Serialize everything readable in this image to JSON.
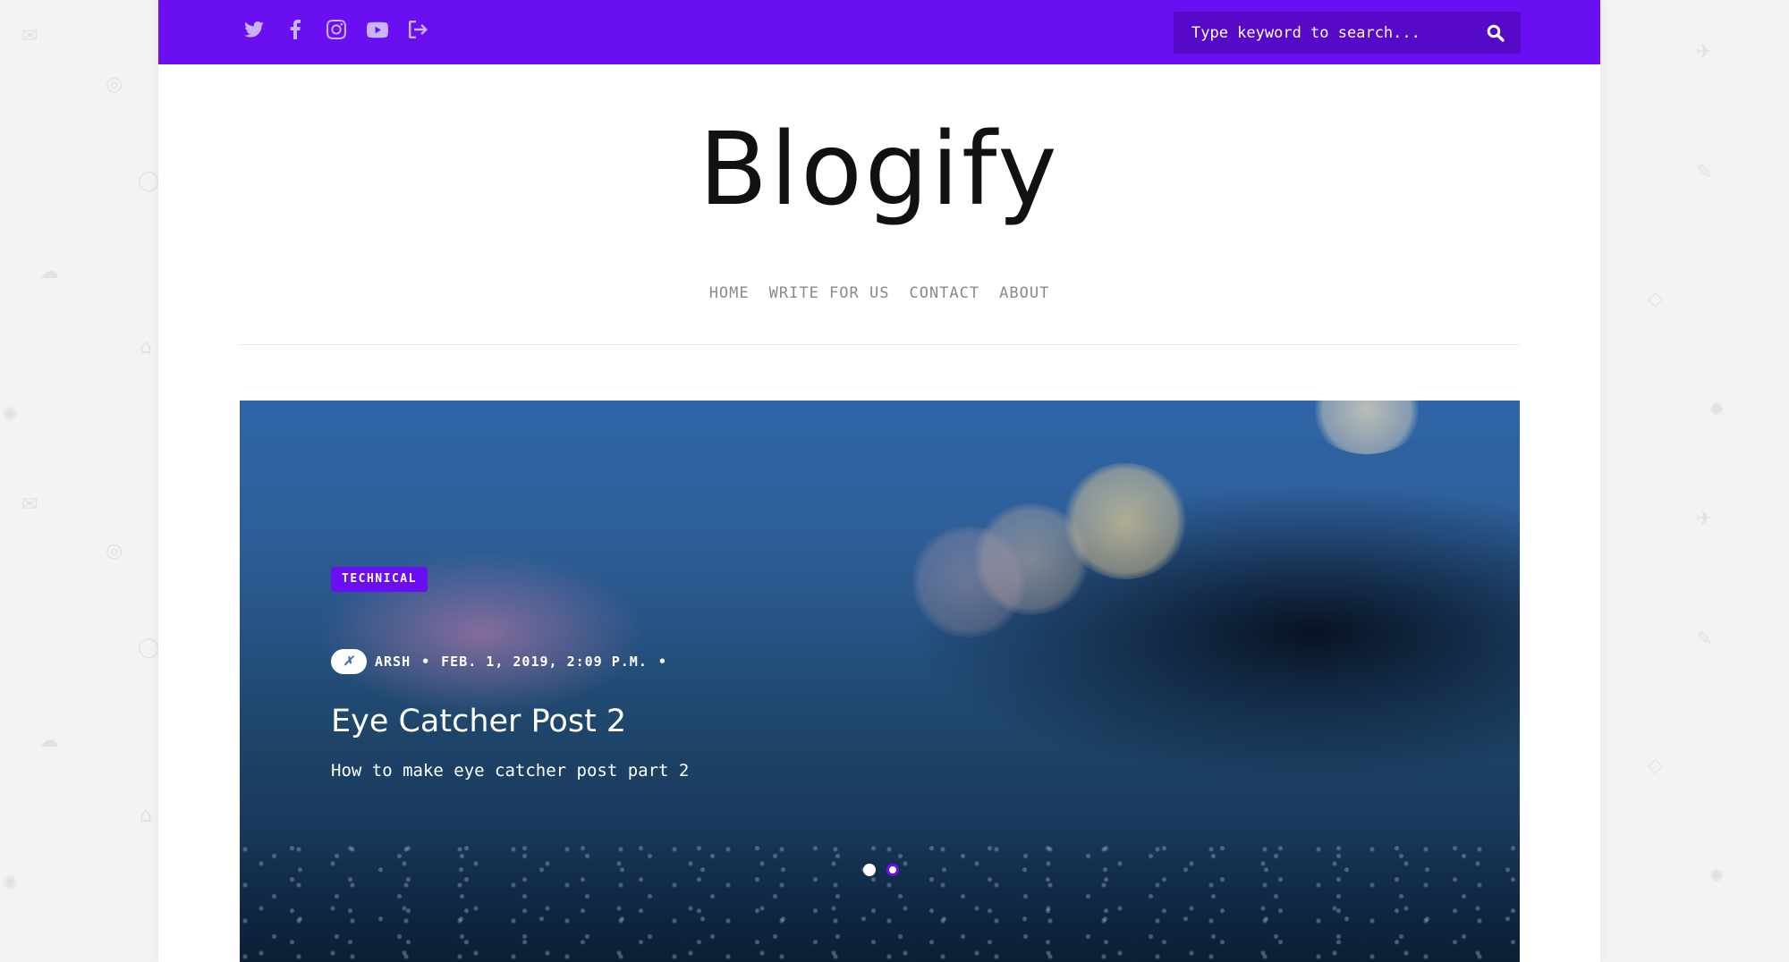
{
  "brand": {
    "name": "Blogify",
    "accent": "#6a0ff2",
    "accent_dark": "#5609c7"
  },
  "topbar": {
    "social_icons": [
      "twitter-icon",
      "facebook-icon",
      "instagram-icon",
      "youtube-icon",
      "logout-icon"
    ],
    "search": {
      "placeholder": "Type keyword to search...",
      "icon": "search-icon"
    }
  },
  "nav": {
    "items": [
      {
        "label": "HOME"
      },
      {
        "label": "WRITE FOR US"
      },
      {
        "label": "CONTACT"
      },
      {
        "label": "ABOUT"
      }
    ]
  },
  "hero": {
    "category": "TECHNICAL",
    "author": "ARSH",
    "meta_separator": "•",
    "date": "FEB. 1, 2019, 2:09 P.M.",
    "title": "Eye Catcher Post 2",
    "excerpt": "How to make eye catcher post part 2",
    "slides_total": 2,
    "active_slide": 2
  }
}
